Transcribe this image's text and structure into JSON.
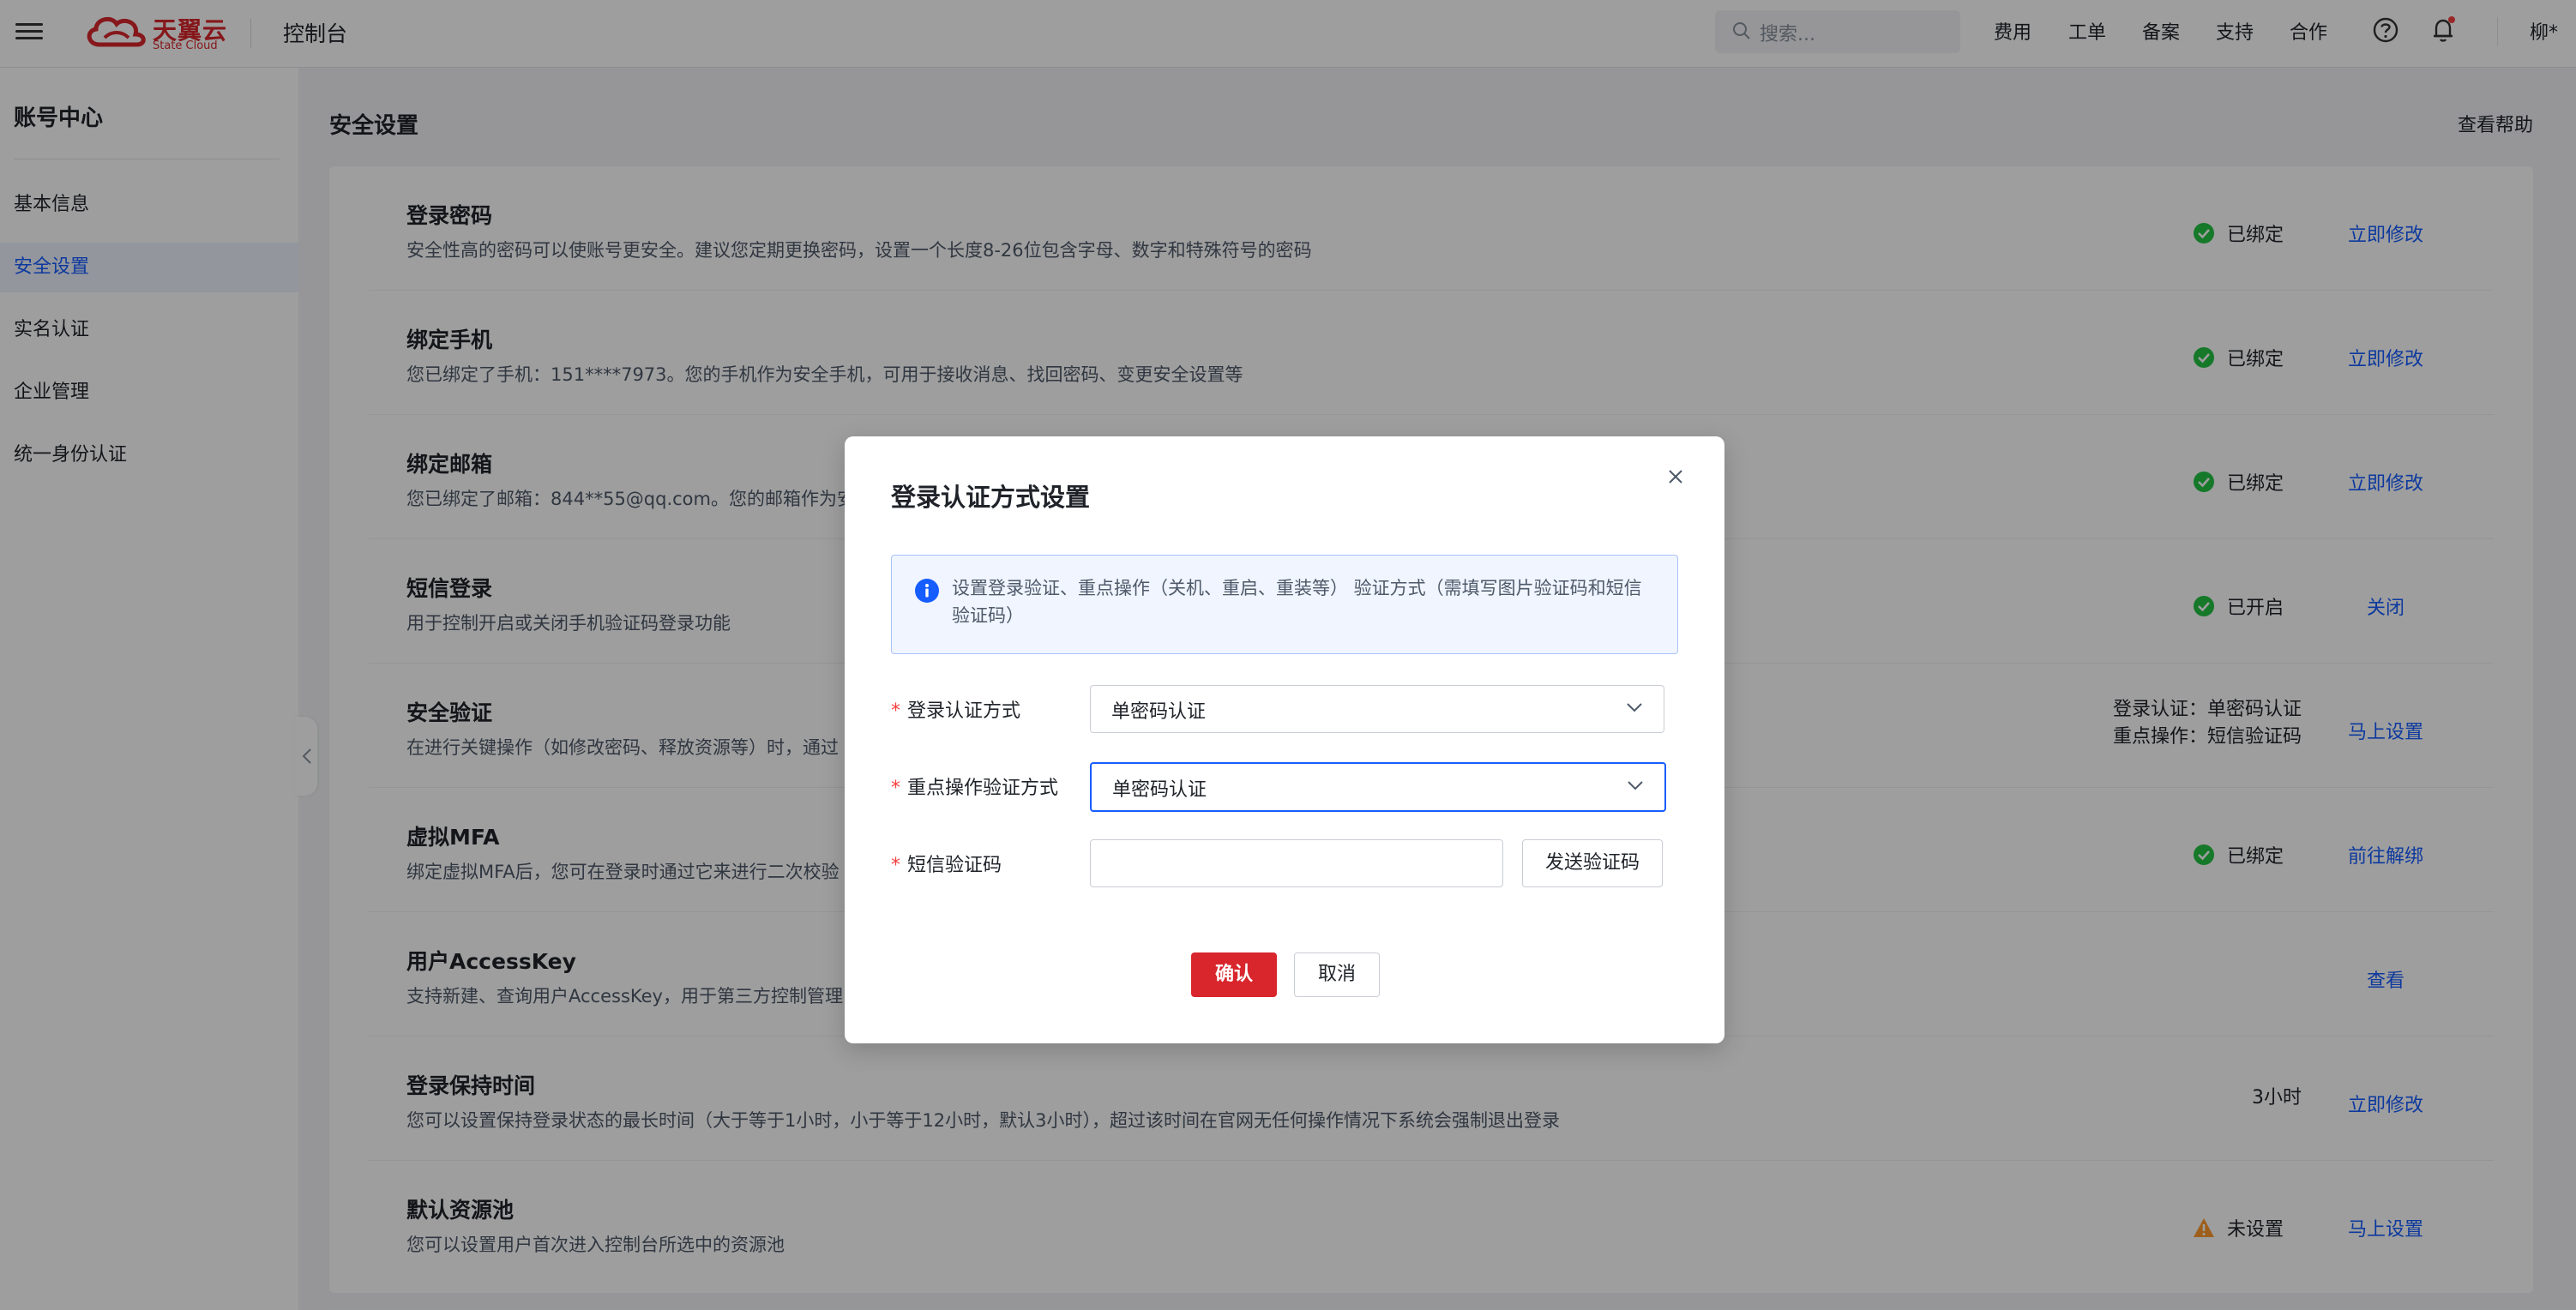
{
  "topbar": {
    "logo_text": "天翼云",
    "logo_sub": "State Cloud",
    "console": "控制台",
    "search_placeholder": "搜索...",
    "nav": [
      "费用",
      "工单",
      "备案",
      "支持",
      "合作"
    ],
    "user": "柳*"
  },
  "sidebar": {
    "title": "账号中心",
    "items": [
      {
        "label": "基本信息"
      },
      {
        "label": "安全设置"
      },
      {
        "label": "实名认证"
      },
      {
        "label": "企业管理"
      },
      {
        "label": "统一身份认证"
      }
    ]
  },
  "main": {
    "title": "安全设置",
    "help": "查看帮助",
    "rows": [
      {
        "title": "登录密码",
        "desc": "安全性高的密码可以使账号更安全。建议您定期更换密码，设置一个长度8-26位包含字母、数字和特殊符号的密码",
        "status": "已绑定",
        "action": "立即修改"
      },
      {
        "title": "绑定手机",
        "desc": "您已绑定了手机：151****7973。您的手机作为安全手机，可用于接收消息、找回密码、变更安全设置等",
        "status": "已绑定",
        "action": "立即修改"
      },
      {
        "title": "绑定邮箱",
        "desc": "您已绑定了邮箱：844**55@qq.com。您的邮箱作为安",
        "status": "已绑定",
        "action": "立即修改"
      },
      {
        "title": "短信登录",
        "desc": "用于控制开启或关闭手机验证码登录功能",
        "status": "已开启",
        "action": "关闭"
      },
      {
        "title": "安全验证",
        "desc": "在进行关键操作（如修改密码、释放资源等）时，通过",
        "value_line1": "登录认证：单密码认证",
        "value_line2": "重点操作：短信验证码",
        "action": "马上设置"
      },
      {
        "title": "虚拟MFA",
        "desc": "绑定虚拟MFA后，您可在登录时通过它来进行二次校验",
        "status": "已绑定",
        "action": "前往解绑"
      },
      {
        "title": "用户AccessKey",
        "desc": "支持新建、查询用户AccessKey，用于第三方控制管理",
        "action": "查看"
      },
      {
        "title": "登录保持时间",
        "desc": "您可以设置保持登录状态的最长时间（大于等于1小时，小于等于12小时，默认3小时），超过该时间在官网无任何操作情况下系统会强制退出登录",
        "value": "3小时",
        "action": "立即修改"
      },
      {
        "title": "默认资源池",
        "desc": "您可以设置用户首次进入控制台所选中的资源池",
        "status": "未设置",
        "action": "马上设置"
      }
    ]
  },
  "modal": {
    "title": "登录认证方式设置",
    "info": "设置登录验证、重点操作（关机、重启、重装等） 验证方式（需填写图片验证码和短信验证码）",
    "login_auth_label": "登录认证方式",
    "login_auth_value": "单密码认证",
    "key_op_label": "重点操作验证方式",
    "key_op_value": "单密码认证",
    "sms_label": "短信验证码",
    "sms_value": "",
    "send_code": "发送验证码",
    "confirm": "确认",
    "cancel": "取消"
  },
  "colors": {
    "brand": "#d8262c",
    "link": "#165dff",
    "success": "#23c343",
    "warning": "#ff9a2e"
  }
}
